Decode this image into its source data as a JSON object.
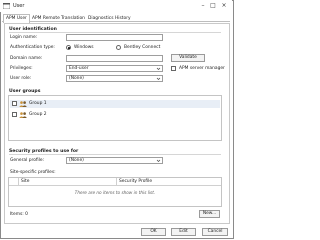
{
  "window": {
    "title": "User"
  },
  "tabs": [
    {
      "label": "APM User"
    },
    {
      "label": "APM Remote"
    },
    {
      "label": "Translation"
    },
    {
      "label": "Diagnostics"
    },
    {
      "label": "History"
    }
  ],
  "user_identification": {
    "heading": "User identification",
    "login_name_label": "Login name:",
    "login_name_value": "",
    "auth_type_label": "Authentication type:",
    "auth_options": [
      "Windows",
      "Bentley Connect"
    ],
    "auth_selected": "Windows",
    "domain_label": "Domain name:",
    "domain_value": "",
    "validate_label": "Validate",
    "privileges_label": "Privileges:",
    "privileges_value": "End-user",
    "apm_server_manager_label": "APM server manager",
    "user_role_label": "User role:",
    "user_role_value": "(None)"
  },
  "user_groups": {
    "heading": "User groups",
    "items": [
      {
        "label": "Group 1",
        "selected": true
      },
      {
        "label": "Group 2",
        "selected": false
      }
    ]
  },
  "security": {
    "heading": "Security profiles to use for",
    "general_label": "General profile:",
    "general_value": "(None)",
    "site_label": "Site-specific profiles:",
    "columns": [
      "Site",
      "Security Profile"
    ],
    "empty_text": "There are no items to show in this list.",
    "items_count": "Items: 0",
    "new_button": "New..."
  },
  "footer": {
    "ok": "OK",
    "edit": "Edit",
    "cancel": "Cancel"
  },
  "colors": {
    "selection": "#e8eef6",
    "accent": "#1a5fb4",
    "group_icon": "#c9923a"
  }
}
